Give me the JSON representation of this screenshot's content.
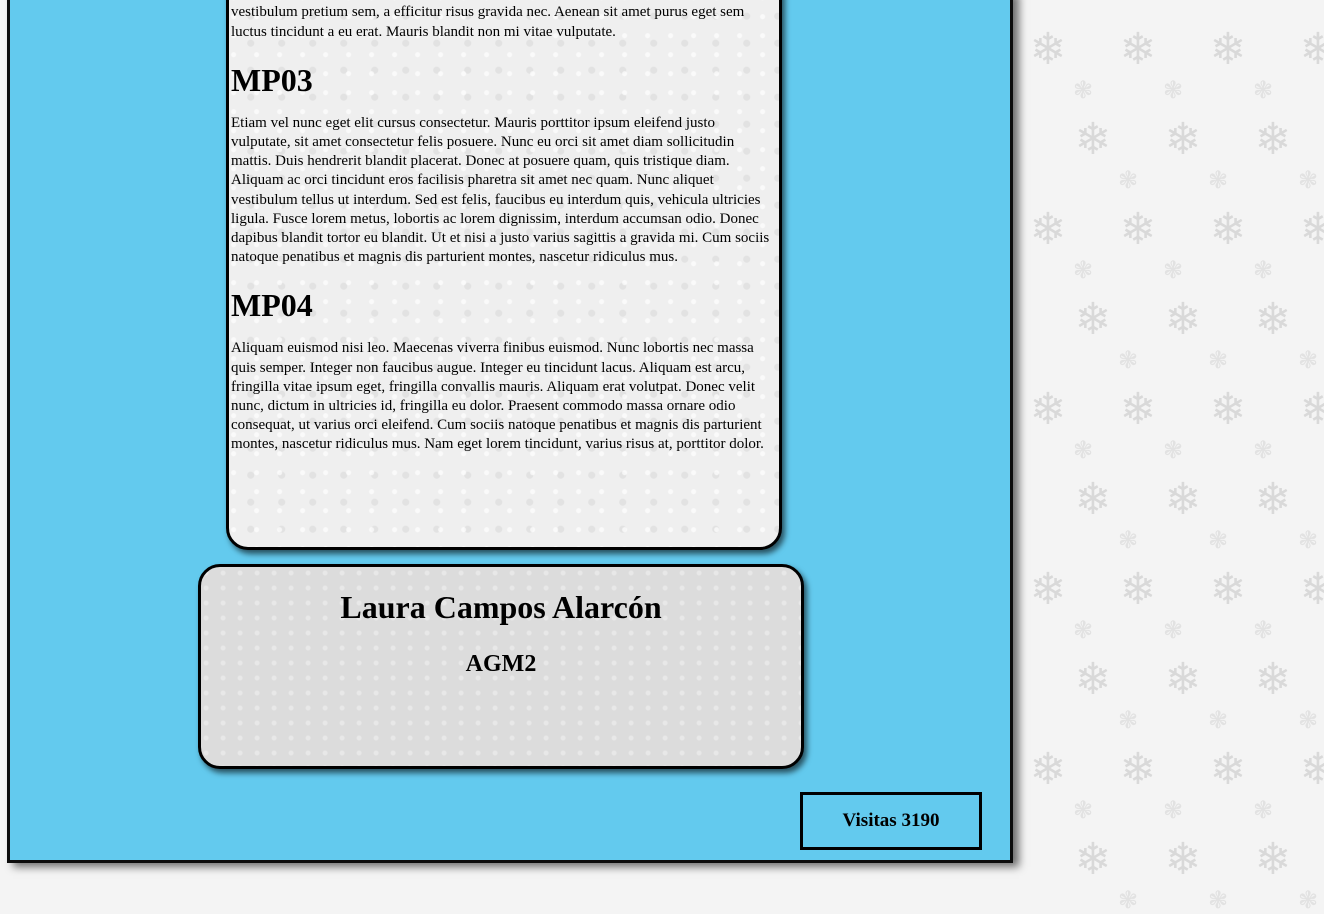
{
  "content": {
    "intro_paragraph_tail": "quis molestie velit imperdiet mollis nulla. Suspendisse ultrices ipsum eget ultrices rhoncus. Nam lorem neque, hendrerit bibendum felis ac, commodo viverra lacus. Nullam vestibulum pretium sem, a efficitur risus gravida nec. Aenean sit amet purus eget sem luctus tincidunt a eu erat. Mauris blandit non mi vitae vulputate.",
    "sections": [
      {
        "heading": "MP03",
        "text": "Etiam vel nunc eget elit cursus consectetur. Mauris porttitor ipsum eleifend justo vulputate, sit amet consectetur felis posuere. Nunc eu orci sit amet diam sollicitudin mattis. Duis hendrerit blandit placerat. Donec at posuere quam, quis tristique diam. Aliquam ac orci tincidunt eros facilisis pharetra sit amet nec quam. Nunc aliquet vestibulum tellus ut interdum. Sed est felis, faucibus eu interdum quis, vehicula ultricies ligula. Fusce lorem metus, lobortis ac lorem dignissim, interdum accumsan odio. Donec dapibus blandit tortor eu blandit. Ut et nisi a justo varius sagittis a gravida mi. Cum sociis natoque penatibus et magnis dis parturient montes, nascetur ridiculus mus."
      },
      {
        "heading": "MP04",
        "text": "Aliquam euismod nisi leo. Maecenas viverra finibus euismod. Nunc lobortis nec massa quis semper. Integer non faucibus augue. Integer eu tincidunt lacus. Aliquam est arcu, fringilla vitae ipsum eget, fringilla convallis mauris. Aliquam erat volutpat. Donec velit nunc, dictum in ultricies id, fringilla eu dolor. Praesent commodo massa ornare odio consequat, ut varius orci eleifend. Cum sociis natoque penatibus et magnis dis parturient montes, nascetur ridiculus mus. Nam eget lorem tincidunt, varius risus at, porttitor dolor."
      }
    ]
  },
  "profile": {
    "name": "Laura Campos Alarcón",
    "group": "AGM2"
  },
  "footer": {
    "visits_label": "Visitas 3190"
  },
  "colors": {
    "frame_background": "#63caee",
    "card_background": "#efefef",
    "profile_background": "#dcdcdc",
    "page_background": "#f4f4f4"
  },
  "icons": {
    "background_pattern": "snowflake-pattern"
  }
}
